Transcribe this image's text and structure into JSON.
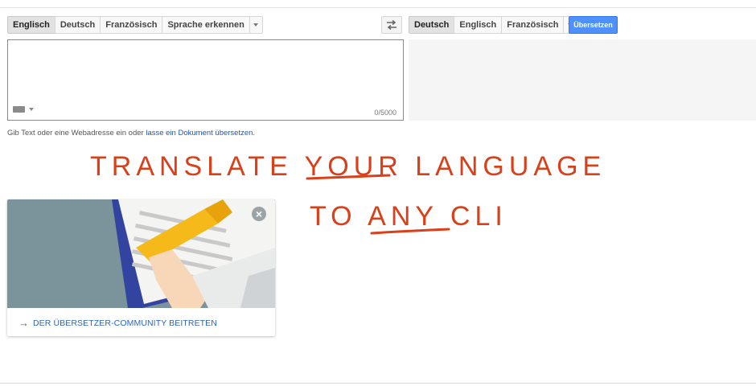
{
  "source_languages": [
    {
      "label": "Englisch",
      "active": true
    },
    {
      "label": "Deutsch",
      "active": false
    },
    {
      "label": "Französisch",
      "active": false
    },
    {
      "label": "Sprache erkennen",
      "active": false
    }
  ],
  "target_languages": [
    {
      "label": "Deutsch",
      "active": true
    },
    {
      "label": "Englisch",
      "active": false
    },
    {
      "label": "Französisch",
      "active": false
    }
  ],
  "icons": {
    "swap": "swap-arrows-icon",
    "dropdown": "chevron-down-icon",
    "keyboard": "keyboard-icon",
    "close": "close-icon",
    "arrow": "arrow-right-icon"
  },
  "translate_button": "Übersetzen",
  "source_input": {
    "value": "",
    "char_count": "0/5000"
  },
  "hint": {
    "prefix": "Gib Text oder eine Webadresse ein oder ",
    "link": "lasse ein Dokument übersetzen",
    "suffix": "."
  },
  "overlay_text": {
    "line1_a": "TRANSLATE ",
    "line1_b": "YOUR",
    "line1_c": " LANGUAGE",
    "line2_a": "TO ",
    "line2_b": "ANY",
    "line2_c": " CLI"
  },
  "community_card": {
    "cta": "DER ÜBERSETZER-COMMUNITY BEITRETEN"
  },
  "colors": {
    "accent": "#4d90fe",
    "link": "#1a55c6",
    "annotation": "#d9401a"
  }
}
